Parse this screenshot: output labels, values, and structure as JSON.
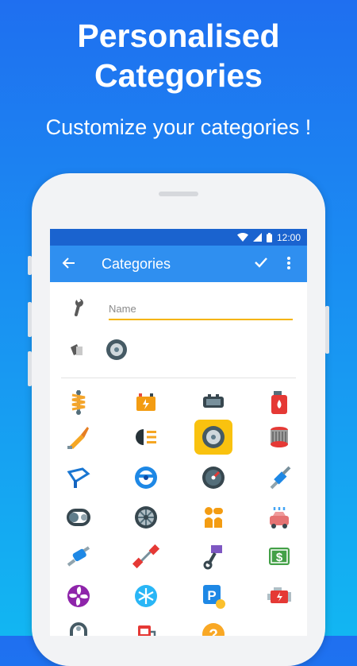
{
  "headline": {
    "line1": "Personalised",
    "line2": "Categories",
    "subtitle": "Customize your categories !"
  },
  "status_bar": {
    "time": "12:00"
  },
  "app_bar": {
    "title": "Categories",
    "back_icon": "arrow-back-icon",
    "confirm_icon": "check-icon",
    "menu_icon": "more-vert-icon"
  },
  "form": {
    "name": {
      "placeholder": "Name",
      "value": ""
    },
    "category_icon": "wrench-icon",
    "color_icon": "tag-icon",
    "selected_icon": "tire-icon"
  },
  "icon_grid": [
    "shock-absorber-icon",
    "battery-icon",
    "brake-pad-icon",
    "fuel-can-icon",
    "spark-plug-icon",
    "headlight-icon",
    "tire-icon",
    "air-filter-icon",
    "wiper-icon",
    "steering-wheel-icon",
    "speedometer-icon",
    "glow-plug-icon",
    "timing-belt-icon",
    "rim-icon",
    "gear-shift-icon",
    "car-wash-icon",
    "exhaust-icon",
    "dumbbell-icon",
    "piston-icon",
    "money-icon",
    "fan-icon",
    "air-conditioning-icon",
    "parking-icon",
    "engine-icon",
    "chain-icon",
    "gas-station-icon",
    "help-icon"
  ],
  "selected_index": 6,
  "colors": {
    "accent": "#f9c20f",
    "app_bar": "#2f8ff0",
    "status_bar": "#1a63cf"
  }
}
